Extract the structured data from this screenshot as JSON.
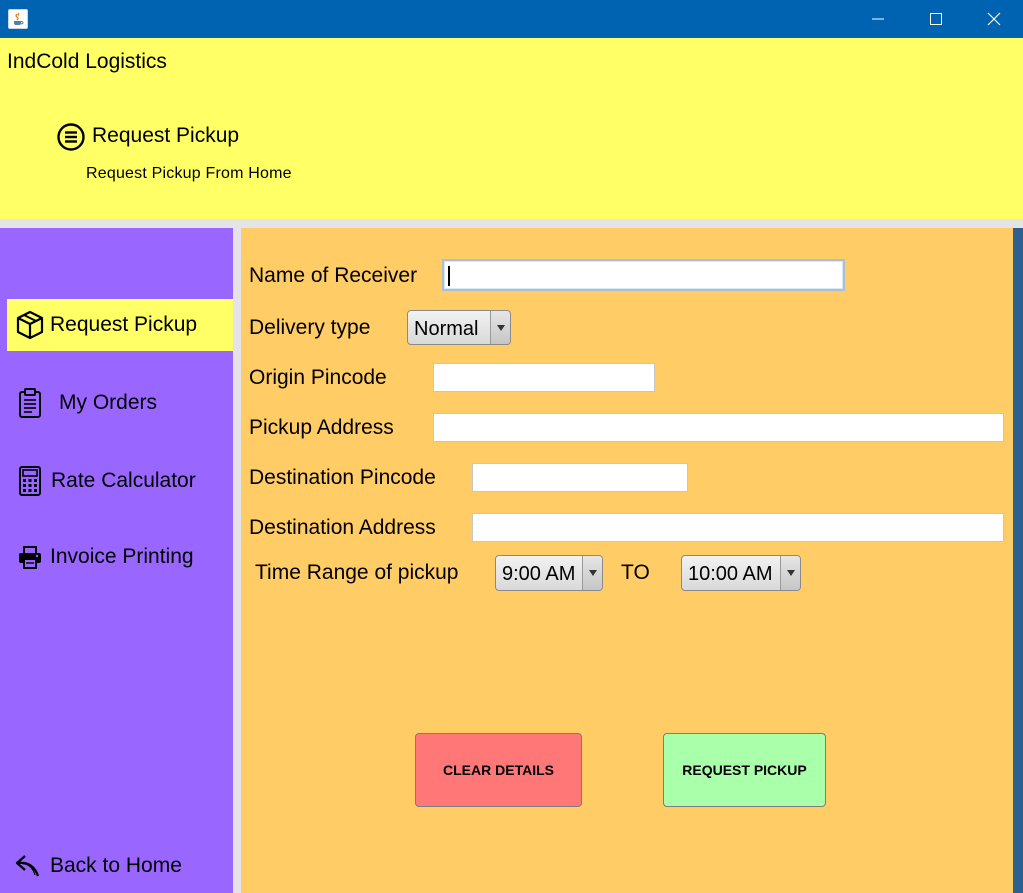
{
  "window": {
    "icon": "java-icon",
    "controls": [
      "minimize-icon",
      "maximize-icon",
      "close-icon"
    ]
  },
  "header": {
    "app_name": "IndCold Logistics",
    "page_title": "Request Pickup",
    "page_subtitle": "Request Pickup From Home",
    "title_icon": "list-circle-icon"
  },
  "sidebar": {
    "items": [
      {
        "label": "Request Pickup",
        "icon": "package-icon",
        "active": true
      },
      {
        "label": "My Orders",
        "icon": "clipboard-icon",
        "active": false
      },
      {
        "label": "Rate Calculator",
        "icon": "calculator-icon",
        "active": false
      },
      {
        "label": "Invoice Printing",
        "icon": "printer-icon",
        "active": false
      }
    ],
    "back": {
      "label": "Back to Home",
      "icon": "back-arrow-icon"
    }
  },
  "form": {
    "receiver_name": {
      "label": "Name of Receiver",
      "value": ""
    },
    "delivery_type": {
      "label": "Delivery type",
      "value": "Normal"
    },
    "origin_pincode": {
      "label": "Origin Pincode",
      "value": ""
    },
    "pickup_address": {
      "label": "Pickup Address",
      "value": ""
    },
    "destination_pincode": {
      "label": "Destination Pincode",
      "value": ""
    },
    "destination_address": {
      "label": "Destination Address",
      "value": ""
    },
    "time_range": {
      "label": "Time Range of pickup",
      "from": "9:00 AM",
      "separator": "TO",
      "to": "10:00 AM"
    }
  },
  "actions": {
    "clear": "CLEAR DETAILS",
    "request": "REQUEST PICKUP"
  },
  "colors": {
    "titlebar": "#0063b1",
    "header": "#ffff66",
    "sidebar": "#9966ff",
    "main": "#ffcc66",
    "clear_button": "#ff7777",
    "request_button": "#aaffaa"
  }
}
